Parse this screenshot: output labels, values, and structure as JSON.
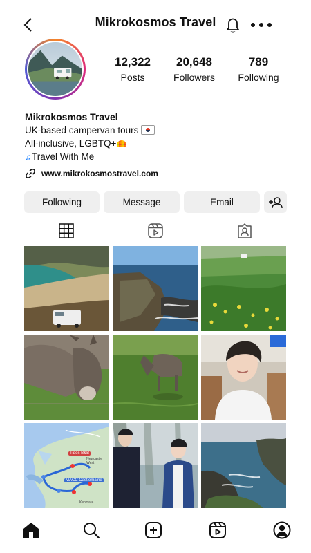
{
  "header": {
    "title": "Mikrokosmos Travel",
    "icons": [
      "back-arrow-icon",
      "bell-icon",
      "more-icon"
    ]
  },
  "profile": {
    "stats": [
      {
        "value": "12,322",
        "label": "Posts"
      },
      {
        "value": "20,648",
        "label": "Followers"
      },
      {
        "value": "789",
        "label": "Following"
      }
    ],
    "name": "Mikrokosmos Travel",
    "bio_line1": "UK-based campervan tours",
    "bio_line2": "All-inclusive, LGBTQ+",
    "bio_line3": "Travel With Me",
    "link": "www.mikrokosmostravel.com"
  },
  "actions": {
    "following": "Following",
    "message": "Message",
    "email": "Email"
  },
  "tabs": [
    "grid-icon",
    "reels-icon",
    "tagged-icon"
  ],
  "grid_posts": [
    "campervan-on-beach-photo",
    "rocky-coastline-photo",
    "green-hillside-flowers-photo",
    "donkey-closeup-photo",
    "donkey-in-field-photo",
    "man-smiling-photo",
    "map-route-photo",
    "two-people-photo",
    "coast-cliffs-photo"
  ],
  "map_labels": {
    "a": "Tides B&B",
    "b": "MACC Castlemaine",
    "c": "Newcastle West",
    "d": "Kenmare"
  },
  "bottom_nav": [
    "home-icon",
    "search-icon",
    "create-icon",
    "reels-nav-icon",
    "profile-icon"
  ],
  "colors": {
    "button_bg": "#efefef",
    "text": "#111111"
  }
}
